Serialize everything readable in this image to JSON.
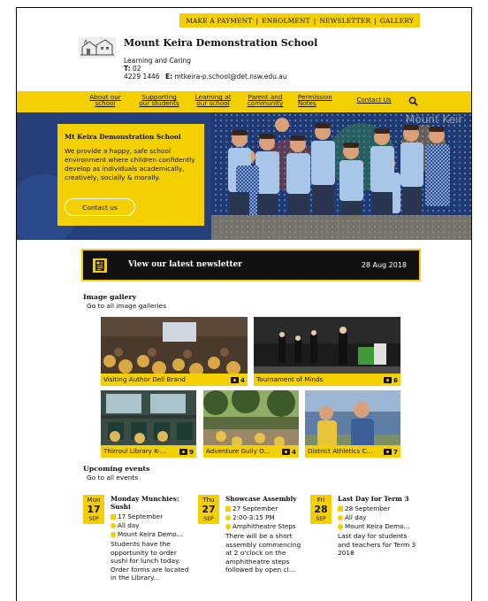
{
  "util_nav": {
    "items": [
      "MAKE A PAYMENT",
      "ENROLMENT",
      "NEWSLETTER",
      "GALLERY"
    ],
    "separator": "|"
  },
  "header": {
    "school_name": "Mount Keira Demonstration School",
    "tagline": "Learning and Caring",
    "phone_label": "T:",
    "phone_value": "02",
    "phone_line2": "4229 1446",
    "email_label": "E:",
    "email_value": "mtkeira-p.school@det.nsw.edu.au"
  },
  "main_nav": {
    "items": [
      {
        "line1": "About our",
        "line2": "school"
      },
      {
        "line1": "Supporting",
        "line2": "our students"
      },
      {
        "line1": "Learning at",
        "line2": "our school"
      },
      {
        "line1": "Parent and",
        "line2": "community"
      },
      {
        "line1": "Permission",
        "line2": "Notes"
      },
      {
        "line1": "Contact Us",
        "line2": ""
      }
    ],
    "search_icon": "search-icon"
  },
  "hero": {
    "title": "Mt Keira Demonstration School",
    "text": "We provide a happy, safe school environment where children confidently develop as individuals academically, creatively, socially & morally.",
    "button": "Contact us",
    "overlay_text": "Mount Keir"
  },
  "newsletter": {
    "label": "View our latest newsletter",
    "date": "28 Aug 2018",
    "icon": "newsletter-icon"
  },
  "gallery": {
    "heading": "Image gallery",
    "link": "Go to all image galleries",
    "tiles": [
      {
        "caption": "Visiting Author Dell Brand",
        "count": "4"
      },
      {
        "caption": "Tournament of Minds",
        "count": "6"
      },
      {
        "caption": "Thirroul Library K-...",
        "count": "9"
      },
      {
        "caption": "Adventure Gully O...",
        "count": "4"
      },
      {
        "caption": "District Athletics C...",
        "count": "7"
      }
    ]
  },
  "events": {
    "heading": "Upcoming events",
    "link": "Go to all events",
    "items": [
      {
        "day": "Mon",
        "date": "17",
        "month": "SEP",
        "title": "Monday Munchies: Sushi",
        "date_text": "17 September",
        "time": "All day",
        "location": "Mount Keira Demo...",
        "description": "Students have the opportunity to order sushi for lunch today. Order forms are located in the Library..."
      },
      {
        "day": "Thu",
        "date": "27",
        "month": "SEP",
        "title": "Showcase Assembly",
        "date_text": "27 September",
        "time": "2:00-3:15 PM",
        "location": "Amphitheatre Steps",
        "description": "There will be a short assembly commencing at 2 o'clock on the amphitheatre steps followed by open cl..."
      },
      {
        "day": "Fri",
        "date": "28",
        "month": "SEP",
        "title": "Last Day for Term 3",
        "date_text": "28 September",
        "time": "All day",
        "location": "Mount Keira Demo...",
        "description": "Last day for students and teachers for Term 3 2018"
      }
    ]
  },
  "colors": {
    "accent": "#f5d000",
    "hero_bg": "#1f3a72",
    "dark": "#111111"
  }
}
